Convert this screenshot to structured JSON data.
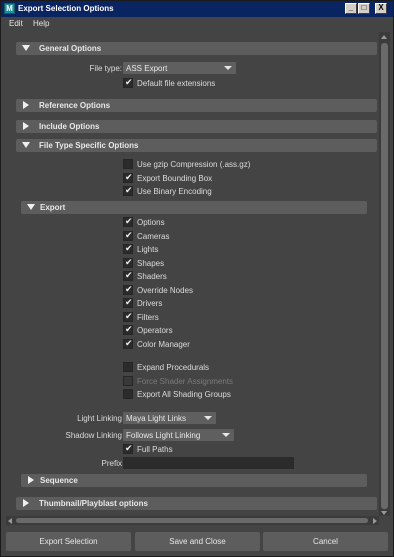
{
  "window": {
    "title": "Export Selection Options",
    "app_icon_letter": "M",
    "minimize": "_",
    "maximize": "□",
    "close": "X"
  },
  "menu": [
    "Edit",
    "Help"
  ],
  "general": {
    "header": "General Options",
    "file_type_label": "File type:",
    "file_type_value": "ASS Export",
    "default_ext_label": "Default file extensions",
    "default_ext_checked": true
  },
  "collapsed_sections": {
    "reference": "Reference Options",
    "include": "Include Options"
  },
  "file_type_specific": {
    "header": "File Type Specific Options",
    "options": [
      {
        "label": "Use gzip Compression (.ass.gz)",
        "checked": false,
        "enabled": true
      },
      {
        "label": "Export Bounding Box",
        "checked": true,
        "enabled": true
      },
      {
        "label": "Use Binary Encoding",
        "checked": true,
        "enabled": true
      }
    ]
  },
  "export": {
    "header": "Export",
    "items": [
      {
        "label": "Options",
        "checked": true,
        "enabled": true
      },
      {
        "label": "Cameras",
        "checked": true,
        "enabled": true
      },
      {
        "label": "Lights",
        "checked": true,
        "enabled": true
      },
      {
        "label": "Shapes",
        "checked": true,
        "enabled": true
      },
      {
        "label": "Shaders",
        "checked": true,
        "enabled": true
      },
      {
        "label": "Override Nodes",
        "checked": true,
        "enabled": true
      },
      {
        "label": "Drivers",
        "checked": true,
        "enabled": true
      },
      {
        "label": "Filters",
        "checked": true,
        "enabled": true
      },
      {
        "label": "Operators",
        "checked": true,
        "enabled": true
      },
      {
        "label": "Color Manager",
        "checked": true,
        "enabled": true
      }
    ],
    "extra": [
      {
        "label": "Expand Procedurals",
        "checked": false,
        "enabled": true
      },
      {
        "label": "Force Shader Assignments",
        "checked": false,
        "enabled": false
      },
      {
        "label": "Export All Shading Groups",
        "checked": false,
        "enabled": true
      }
    ],
    "light_linking_label": "Light Linking",
    "light_linking_value": "Maya Light Links",
    "shadow_linking_label": "Shadow Linking",
    "shadow_linking_value": "Follows Light Linking",
    "full_paths_label": "Full Paths",
    "full_paths_checked": true,
    "prefix_label": "Prefix",
    "prefix_value": ""
  },
  "sequence": {
    "header": "Sequence"
  },
  "thumbnail": {
    "header": "Thumbnail/Playblast options"
  },
  "buttons": {
    "export": "Export Selection",
    "save_close": "Save and Close",
    "cancel": "Cancel"
  },
  "colors": {
    "title_bar": "#0a2462",
    "background": "#444444",
    "section_header": "#5d5d5d",
    "checkbox": "#2b2b2b"
  }
}
